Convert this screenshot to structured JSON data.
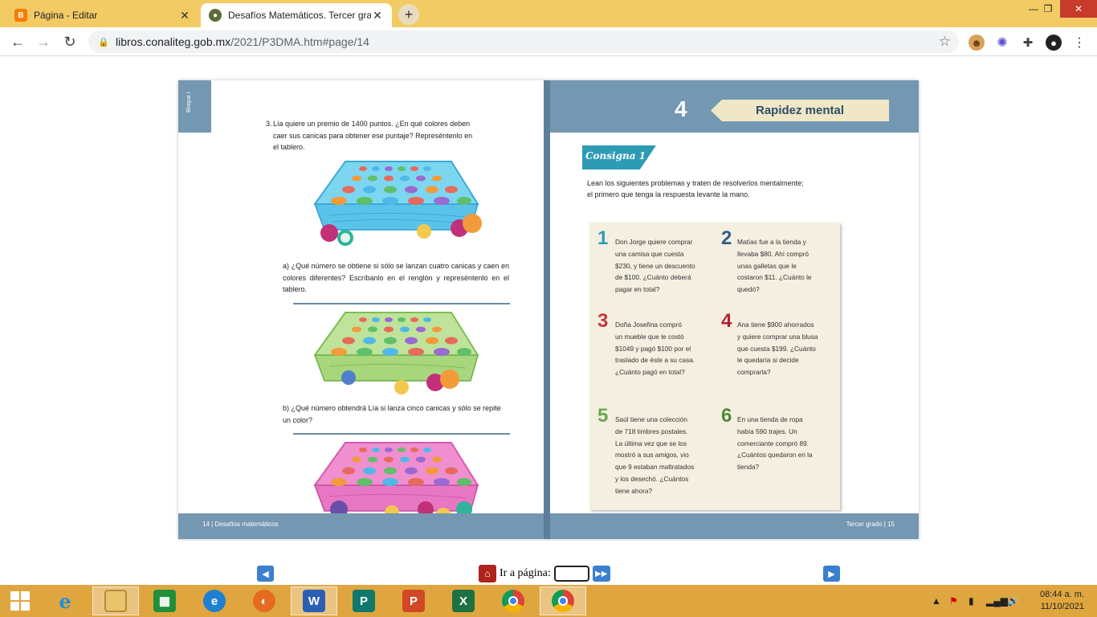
{
  "browser": {
    "tabs": [
      {
        "title": "Página - Editar",
        "icon": "blogger-icon"
      },
      {
        "title": "Desafíos Matemáticos. Tercer gra",
        "icon": "seal-icon"
      }
    ],
    "url_host": "libros.conaliteg.gob.mx",
    "url_path": "/2021/P3DMA.htm#page/14"
  },
  "left_page": {
    "bloque_label": "Bloque I",
    "q3_number": "3.",
    "q3_lines": [
      "Lía quiere un premio de 1400 puntos. ¿En qué colores deben",
      "caer sus canicas para obtener ese puntaje? Represéntenlo en",
      "el tablero."
    ],
    "qa_text": "a) ¿Qué número se obtiene si sólo se lanzan cuatro canicas y caen en colores diferentes? Escríbanlo en el renglón y represéntenlo en el tablero.",
    "qb_text": "b) ¿Qué número obtendrá Lía si lanza cinco canicas y sólo se repite un color?",
    "footer": "14 | Desafíos matemáticos"
  },
  "right_page": {
    "lesson_number": "4",
    "lesson_title": "Rapidez mental",
    "consigna": "Consigna 1",
    "instructions": [
      "Lean los siguientes problemas y traten de resolverlos mentalmente;",
      "el primero que tenga la respuesta levante la mano."
    ],
    "problems": [
      {
        "n": "1",
        "lines": [
          "Don Jorge quiere comprar",
          "una camisa que cuesta",
          "$230, y tiene un descuento",
          "de $100. ¿Cuánto deberá",
          "pagar en total?"
        ]
      },
      {
        "n": "2",
        "lines": [
          "Matías fue a la tienda y",
          "llevaba $80. Ahí compró",
          "unas galletas que le",
          "costaron $11. ¿Cuánto le",
          "quedó?"
        ]
      },
      {
        "n": "3",
        "lines": [
          "Doña Josefina compró",
          "un mueble que le costó",
          "$1049 y pagó $100 por el",
          "traslado de éste a su casa.",
          "¿Cuánto pagó en total?"
        ]
      },
      {
        "n": "4",
        "lines": [
          "Ana tiene $900 ahorrados",
          "y quiere comprar una blusa",
          "que cuesta $199. ¿Cuánto",
          "le quedaría si decide",
          "comprarla?"
        ]
      },
      {
        "n": "5",
        "lines": [
          "Saúl tiene una colección",
          "de 718 timbres postales.",
          "La última vez que se los",
          "mostró a sus amigos, vio",
          "que 9 estaban maltratados",
          "y los desechó. ¿Cuántos",
          "tiene ahora?"
        ]
      },
      {
        "n": "6",
        "lines": [
          "En una tienda de ropa",
          "había 590 trajes. Un",
          "comerciante compró 89.",
          "¿Cuántos quedaron en la",
          "tienda?"
        ]
      }
    ],
    "footer": "Tercer grado | 15"
  },
  "viewer_nav": {
    "goto_label": "Ir a página:",
    "goto_value": ""
  },
  "taskbar": {
    "time": "08:44 a. m.",
    "date": "11/10/2021",
    "apps": [
      "windows-start-icon",
      "internet-explorer-icon",
      "file-explorer-icon",
      "microsoft-store-icon",
      "edge-icon",
      "firefox-icon",
      "word-icon",
      "publisher-icon",
      "powerpoint-icon",
      "excel-icon",
      "chrome-icon",
      "chrome-profile-icon"
    ]
  },
  "colors": {
    "tabbar": "#f2cb64",
    "page_band": "#7497b2",
    "taskbar": "#dfa640",
    "problem_numbers": [
      "#2e9bb6",
      "#2f5d86",
      "#c0393b",
      "#b02436",
      "#6aa84f",
      "#4f8a3a"
    ]
  }
}
